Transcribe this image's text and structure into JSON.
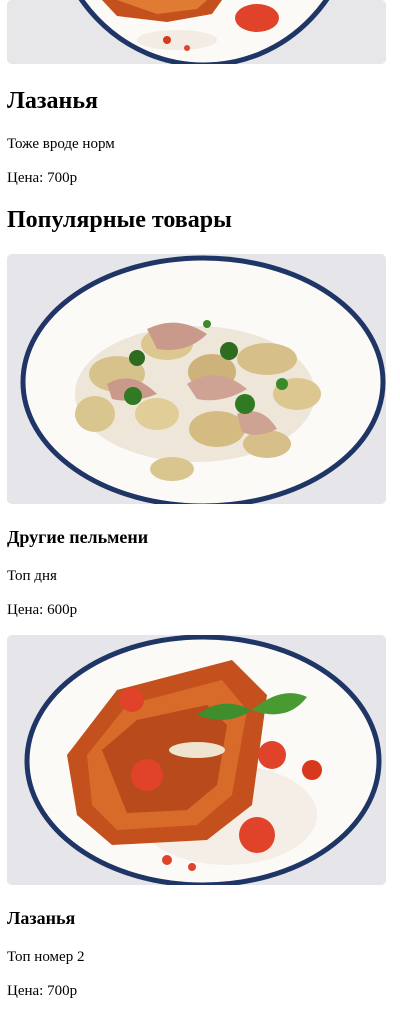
{
  "top_product": {
    "image_icon": "lasagna-plate-image",
    "title": "Лазанья",
    "description": "Тоже вроде норм",
    "price": "Цена: 700р"
  },
  "popular": {
    "heading": "Популярные товары",
    "items": [
      {
        "image_icon": "dumplings-plate-image",
        "title": "Другие пельмени",
        "description": "Топ дня",
        "price": "Цена: 600р"
      },
      {
        "image_icon": "lasagna-plate-image",
        "title": "Лазанья",
        "description": "Топ номер 2",
        "price": "Цена: 700р"
      }
    ]
  },
  "colors": {
    "plate_rim": "#1f3566",
    "plate_inner": "#fbfaf7",
    "background_image": "#e6e6ea",
    "sauce_red": "#e0432a"
  }
}
